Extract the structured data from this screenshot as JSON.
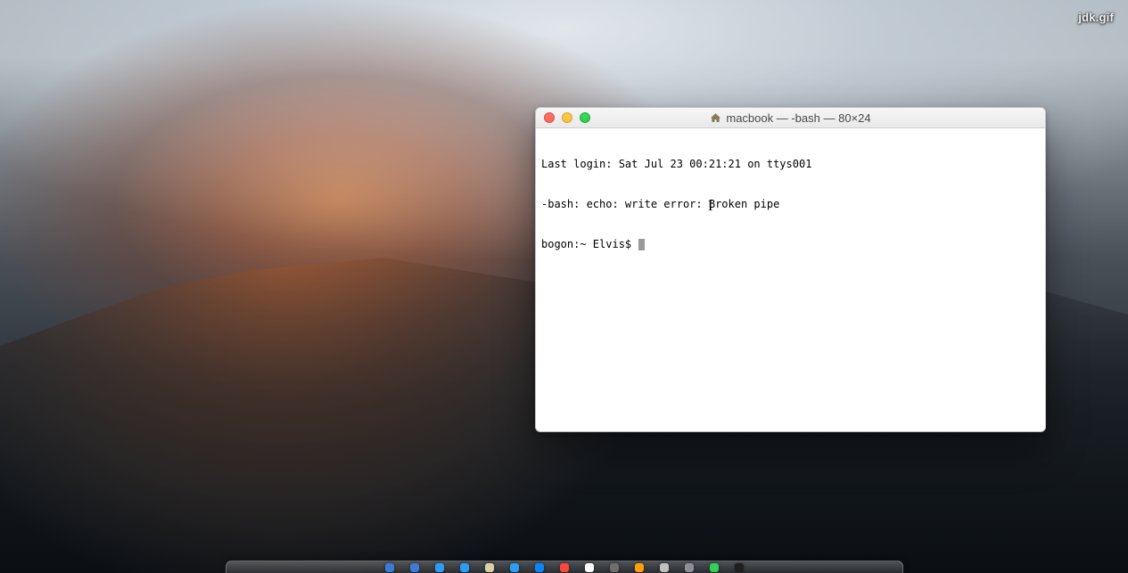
{
  "desktop": {
    "file_label": "jdk.gif"
  },
  "terminal": {
    "title": "macbook — -bash — 80×24",
    "lines": [
      "Last login: Sat Jul 23 00:21:21 on ttys001",
      "-bash: echo: write error: Broken pipe"
    ],
    "prompt": "bogon:~ Elvis$ "
  },
  "colors": {
    "traffic_red": "#ff5f57",
    "traffic_yellow": "#ffbd2e",
    "traffic_green": "#28c940"
  },
  "dock": {
    "items": [
      "#3a7bd5",
      "#3a7bd5",
      "#2a9df4",
      "#2a9df4",
      "#d9cfa3",
      "#2a9df4",
      "#0a84ff",
      "#ff453a",
      "#ffffff",
      "#6e6e6e",
      "#ff9f0a",
      "#c0c0c0",
      "#8e8e93",
      "#30d158",
      "#1f1f1f"
    ]
  }
}
